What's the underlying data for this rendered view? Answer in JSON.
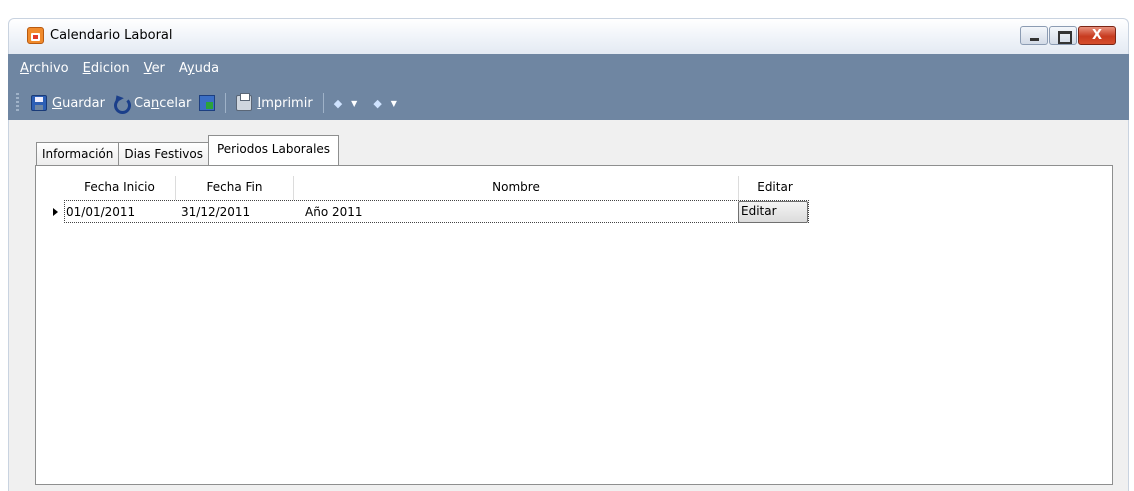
{
  "window": {
    "title": "Calendario Laboral",
    "minimize": "minimize",
    "maximize": "maximize",
    "close": "X"
  },
  "menu": {
    "items": [
      {
        "pre": "",
        "accel": "A",
        "post": "rchivo"
      },
      {
        "pre": "",
        "accel": "E",
        "post": "dicion"
      },
      {
        "pre": "",
        "accel": "V",
        "post": "er"
      },
      {
        "pre": "A",
        "accel": "y",
        "post": "uda"
      }
    ]
  },
  "toolbar": {
    "save_pre": "",
    "save_accel": "G",
    "save_post": "uardar",
    "cancel_pre": "Ca",
    "cancel_accel": "n",
    "cancel_post": "celar",
    "print_pre": "",
    "print_accel": "I",
    "print_post": "mprimir"
  },
  "tabs": [
    {
      "label": "Información",
      "active": false
    },
    {
      "label": "Dias Festivos",
      "active": false
    },
    {
      "label": "Periodos Laborales",
      "active": true
    }
  ],
  "grid": {
    "columns": [
      "Fecha Inicio",
      "Fecha Fin",
      "Nombre",
      "Editar"
    ],
    "rows": [
      {
        "fecha_inicio": "01/01/2011",
        "fecha_fin": "31/12/2011",
        "nombre": "Año 2011",
        "editar": "Editar"
      }
    ]
  },
  "colors": {
    "band": "#6f86a2",
    "content_bg": "#f0f0f0",
    "close_button": "#c73b1f"
  }
}
